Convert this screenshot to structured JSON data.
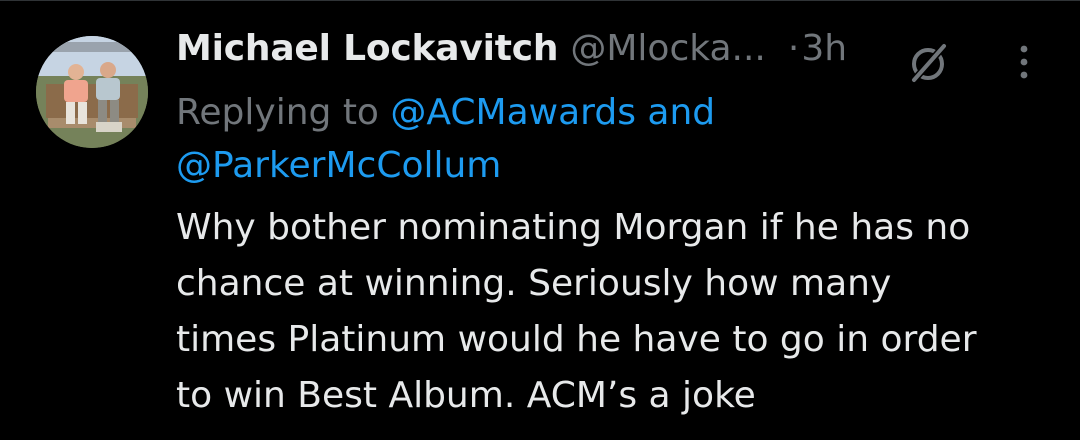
{
  "tweet": {
    "display_name": "Michael Lockavitch",
    "handle": "@Mlocka...",
    "separator": "·",
    "time": "3h",
    "replying_prefix": "Replying to",
    "mentions": [
      "@ACMawards",
      "@ParkerMcCollum"
    ],
    "mention_joiner": "and",
    "body_lines": [
      "Why bother nominating Morgan if he has no",
      "chance at winning. Seriously how many",
      "times Platinum would he have to go in order",
      "to win Best Album. ACM’s a joke"
    ],
    "icons": {
      "grok": "grok-icon",
      "more": "more-icon",
      "avatar": "avatar"
    }
  },
  "colors": {
    "background": "#000000",
    "primary_text": "#e7e9ea",
    "secondary_text": "#71767b",
    "link": "#1d9bf0"
  }
}
